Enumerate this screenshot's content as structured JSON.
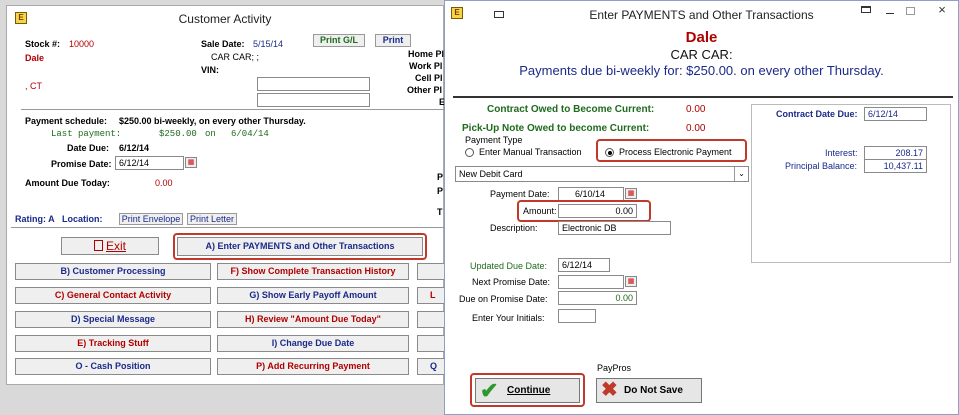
{
  "customer_window": {
    "title": "Customer Activity",
    "stock_label": "Stock #:",
    "stock_value": "10000",
    "name": "Dale",
    "state": ", CT",
    "sale_date_label": "Sale Date:",
    "sale_date_value": "5/15/14",
    "print_gl_label": "Print G/L",
    "print_label": "Print",
    "vehicle": "CAR CAR; ;",
    "vin_label": "VIN:",
    "home_phone": "Home Pl",
    "work_phone": "Work Pl",
    "cell_phone": "Cell Pl",
    "other_phone": "Other Pl",
    "email_cut": "E",
    "payment_schedule_label": "Payment schedule:",
    "payment_schedule_value": "$250.00 bi-weekly, on every other Thursday.",
    "last_payment": "Last payment:",
    "last_payment_amount": "$250.00",
    "last_payment_on": "on",
    "last_payment_date": "6/04/14",
    "date_due_label": "Date Due:",
    "date_due_value": "6/12/14",
    "promise_date_label": "Promise Date:",
    "promise_date_value": "6/12/14",
    "amount_due_label": "Amount Due Today:",
    "amount_due_value": "0.00",
    "right_cut_p1": "P",
    "right_cut_p2": "P",
    "right_cut_t": "T",
    "rating_label": "Rating: A",
    "location_label": "Location:",
    "print_envelope": "Print Envelope",
    "print_letter": "Print Letter",
    "exit_label": "Exit",
    "buttons": {
      "enter_payments": "A) Enter PAYMENTS and Other Transactions",
      "customer_processing": "B) Customer Processing",
      "transaction_history": "F) Show Complete Transaction History",
      "general_contact": "C) General Contact Activity",
      "early_payoff": "G) Show Early Payoff Amount",
      "special_message": "D) Special Message",
      "review_amount_due": "H) Review \"Amount Due Today\"",
      "tracking_stuff": "E) Tracking Stuff",
      "change_due_date": "I) Change Due Date",
      "cash_position": "O - Cash Position",
      "add_recurring": "P) Add Recurring Payment",
      "cut_l": "L",
      "cut_q": "Q"
    }
  },
  "payments_window": {
    "title": "Enter PAYMENTS and Other Transactions",
    "name": "Dale",
    "vehicle": "CAR CAR:",
    "schedule_text": "Payments due bi-weekly for: $250.00. on every other Thursday.",
    "contract_owed_label": "Contract Owed to Become Current:",
    "contract_owed_value": "0.00",
    "pickup_note_label": "Pick-Up Note Owed to become Current:",
    "pickup_note_value": "0.00",
    "payment_type_label": "Payment Type",
    "manual_option": "Enter Manual Transaction",
    "electronic_option": "Process Electronic Payment",
    "card_select": "New Debit Card",
    "payment_date_label": "Payment Date:",
    "payment_date_value": "6/10/14",
    "amount_label": "Amount:",
    "amount_value": "0.00",
    "description_label": "Description:",
    "description_value": "Electronic DB",
    "updated_due_label": "Updated Due Date:",
    "updated_due_value": "6/12/14",
    "next_promise_label": "Next Promise Date:",
    "next_promise_value": "",
    "due_on_promise_label": "Due on Promise Date:",
    "due_on_promise_value": "0.00",
    "initials_label": "Enter Your Initials:",
    "initials_value": "",
    "contract_date_due_label": "Contract Date Due:",
    "contract_date_due_value": "6/12/14",
    "interest_label": "Interest:",
    "interest_value": "208.17",
    "principal_label": "Principal Balance:",
    "principal_value": "10,437.11",
    "paypros_label": "PayPros",
    "continue_label": "Continue",
    "do_not_save_label": "Do Not Save"
  },
  "colors": {
    "highlight": "#c0392b",
    "accent_red": "#b00000",
    "accent_green": "#1e6b1e",
    "accent_navy": "#1a2a8a"
  }
}
